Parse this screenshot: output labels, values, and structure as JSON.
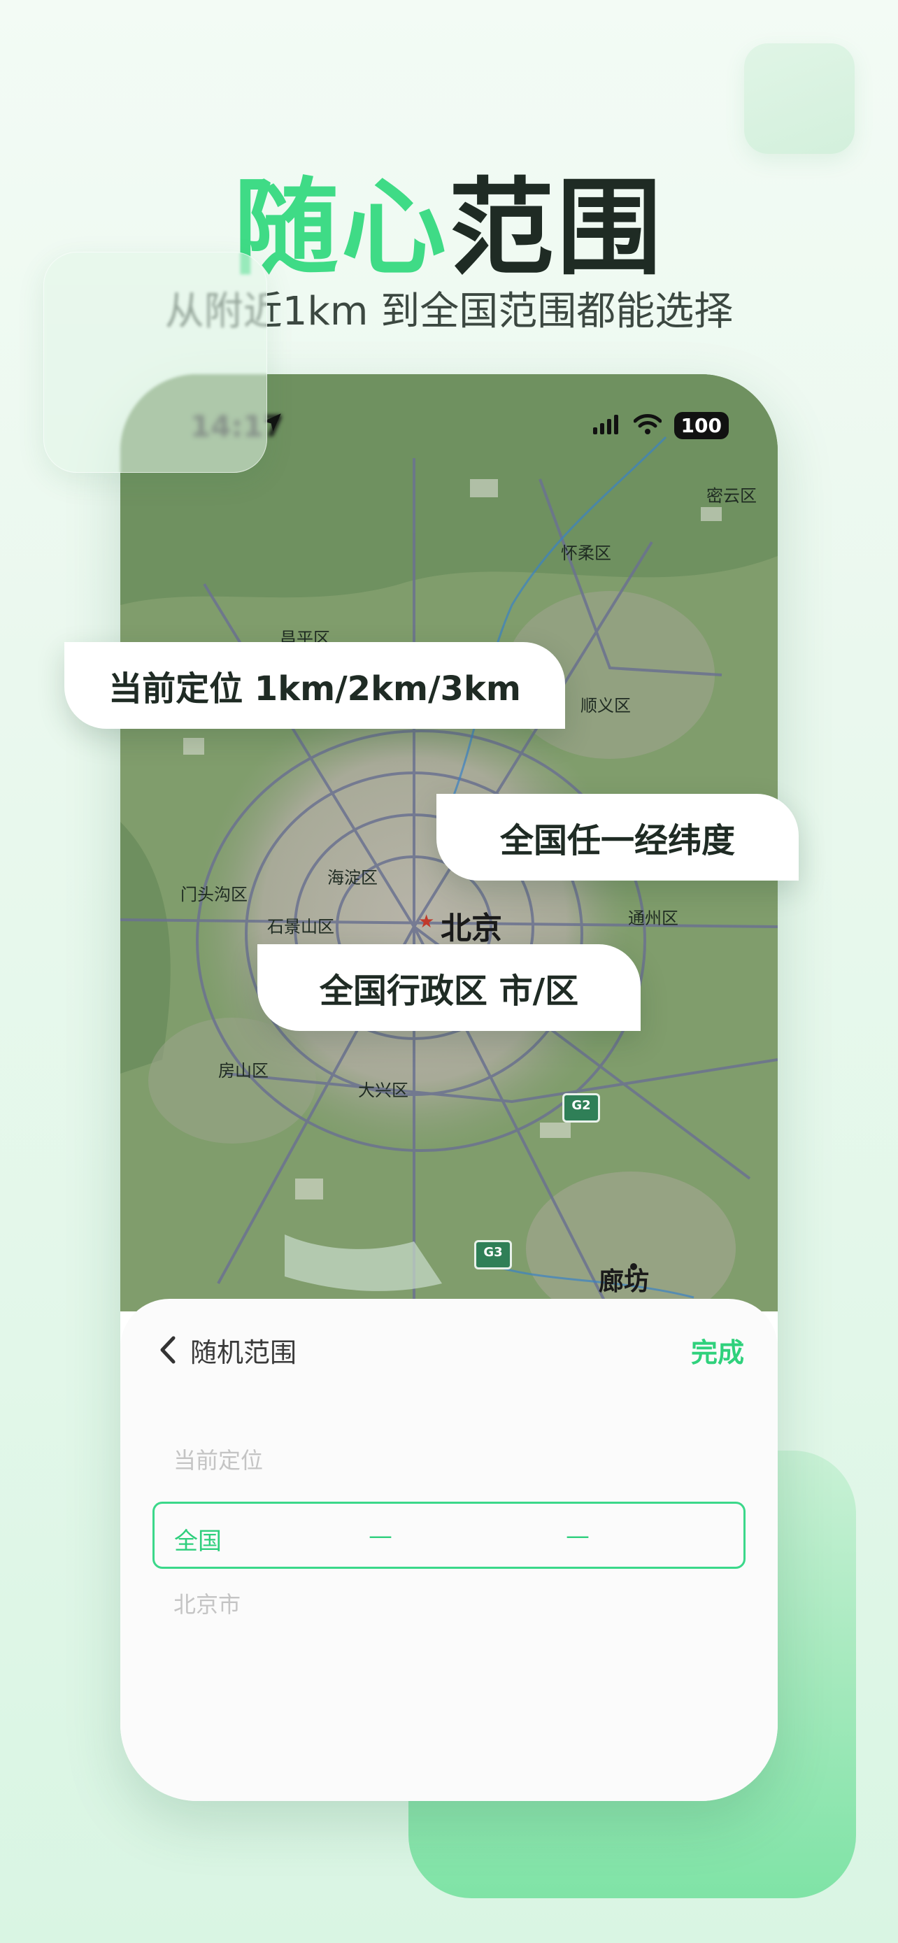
{
  "headline": {
    "accent": "随心",
    "rest": "范围"
  },
  "subheadline": "从附近1km 到全国范围都能选择",
  "statusbar": {
    "time": "14:17",
    "battery": "100"
  },
  "map": {
    "labels": {
      "miyun": "密云区",
      "huairou": "怀柔区",
      "changping": "昌平区",
      "shunyi": "顺义区",
      "haidian": "海淀区",
      "mentougou": "门头沟区",
      "shijingshan": "石景山区",
      "beijing": "北京",
      "tongzhou": "通州区",
      "fangshan": "房山区",
      "daxing": "大兴区",
      "langfang": "廊坊"
    },
    "shields": {
      "g2": "G2",
      "g3": "G3"
    }
  },
  "bubbles": {
    "current": "当前定位 1km/2km/3km",
    "anycoord": "全国任一经纬度",
    "admin": "全国行政区 市/区"
  },
  "sheet": {
    "title": "随机范围",
    "done": "完成",
    "options": {
      "above": "当前定位",
      "selected": "全国",
      "below": "北京市"
    },
    "col2": "—",
    "col3": "—"
  },
  "colors": {
    "accent": "#3fdb86",
    "dark": "#1f2b24"
  }
}
